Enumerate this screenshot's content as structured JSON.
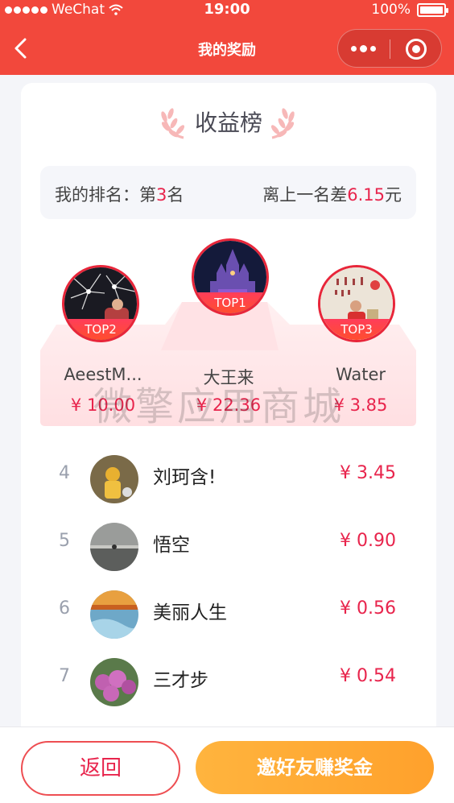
{
  "status_bar": {
    "carrier": "WeChat",
    "time": "19:00",
    "battery": "100%"
  },
  "nav": {
    "title": "我的奖励"
  },
  "board": {
    "title": "收益榜",
    "my_rank_prefix": "我的排名：第",
    "my_rank_number": "3",
    "my_rank_suffix": "名",
    "gap_prefix": "离上一名差",
    "gap_amount": "6.15",
    "gap_suffix": "元"
  },
  "podium": [
    {
      "tag": "TOP2",
      "name": "AeestM...",
      "amount": "¥ 10.00"
    },
    {
      "tag": "TOP1",
      "name": "大王来",
      "amount": "¥ 22.36"
    },
    {
      "tag": "TOP3",
      "name": "Water",
      "amount": "¥ 3.85"
    }
  ],
  "watermark": "微擎应用商城",
  "list": [
    {
      "rank": "4",
      "name": "刘珂含!",
      "amount": "¥ 3.45"
    },
    {
      "rank": "5",
      "name": "悟空",
      "amount": "¥ 0.90"
    },
    {
      "rank": "6",
      "name": "美丽人生",
      "amount": "¥ 0.56"
    },
    {
      "rank": "7",
      "name": "三才步",
      "amount": "¥ 0.54"
    }
  ],
  "actions": {
    "back_label": "返回",
    "invite_label": "邀好友赚奖金"
  },
  "colors": {
    "primary": "#f2483c",
    "accent_red": "#e8244c",
    "invite_orange": "#ffa12c"
  }
}
